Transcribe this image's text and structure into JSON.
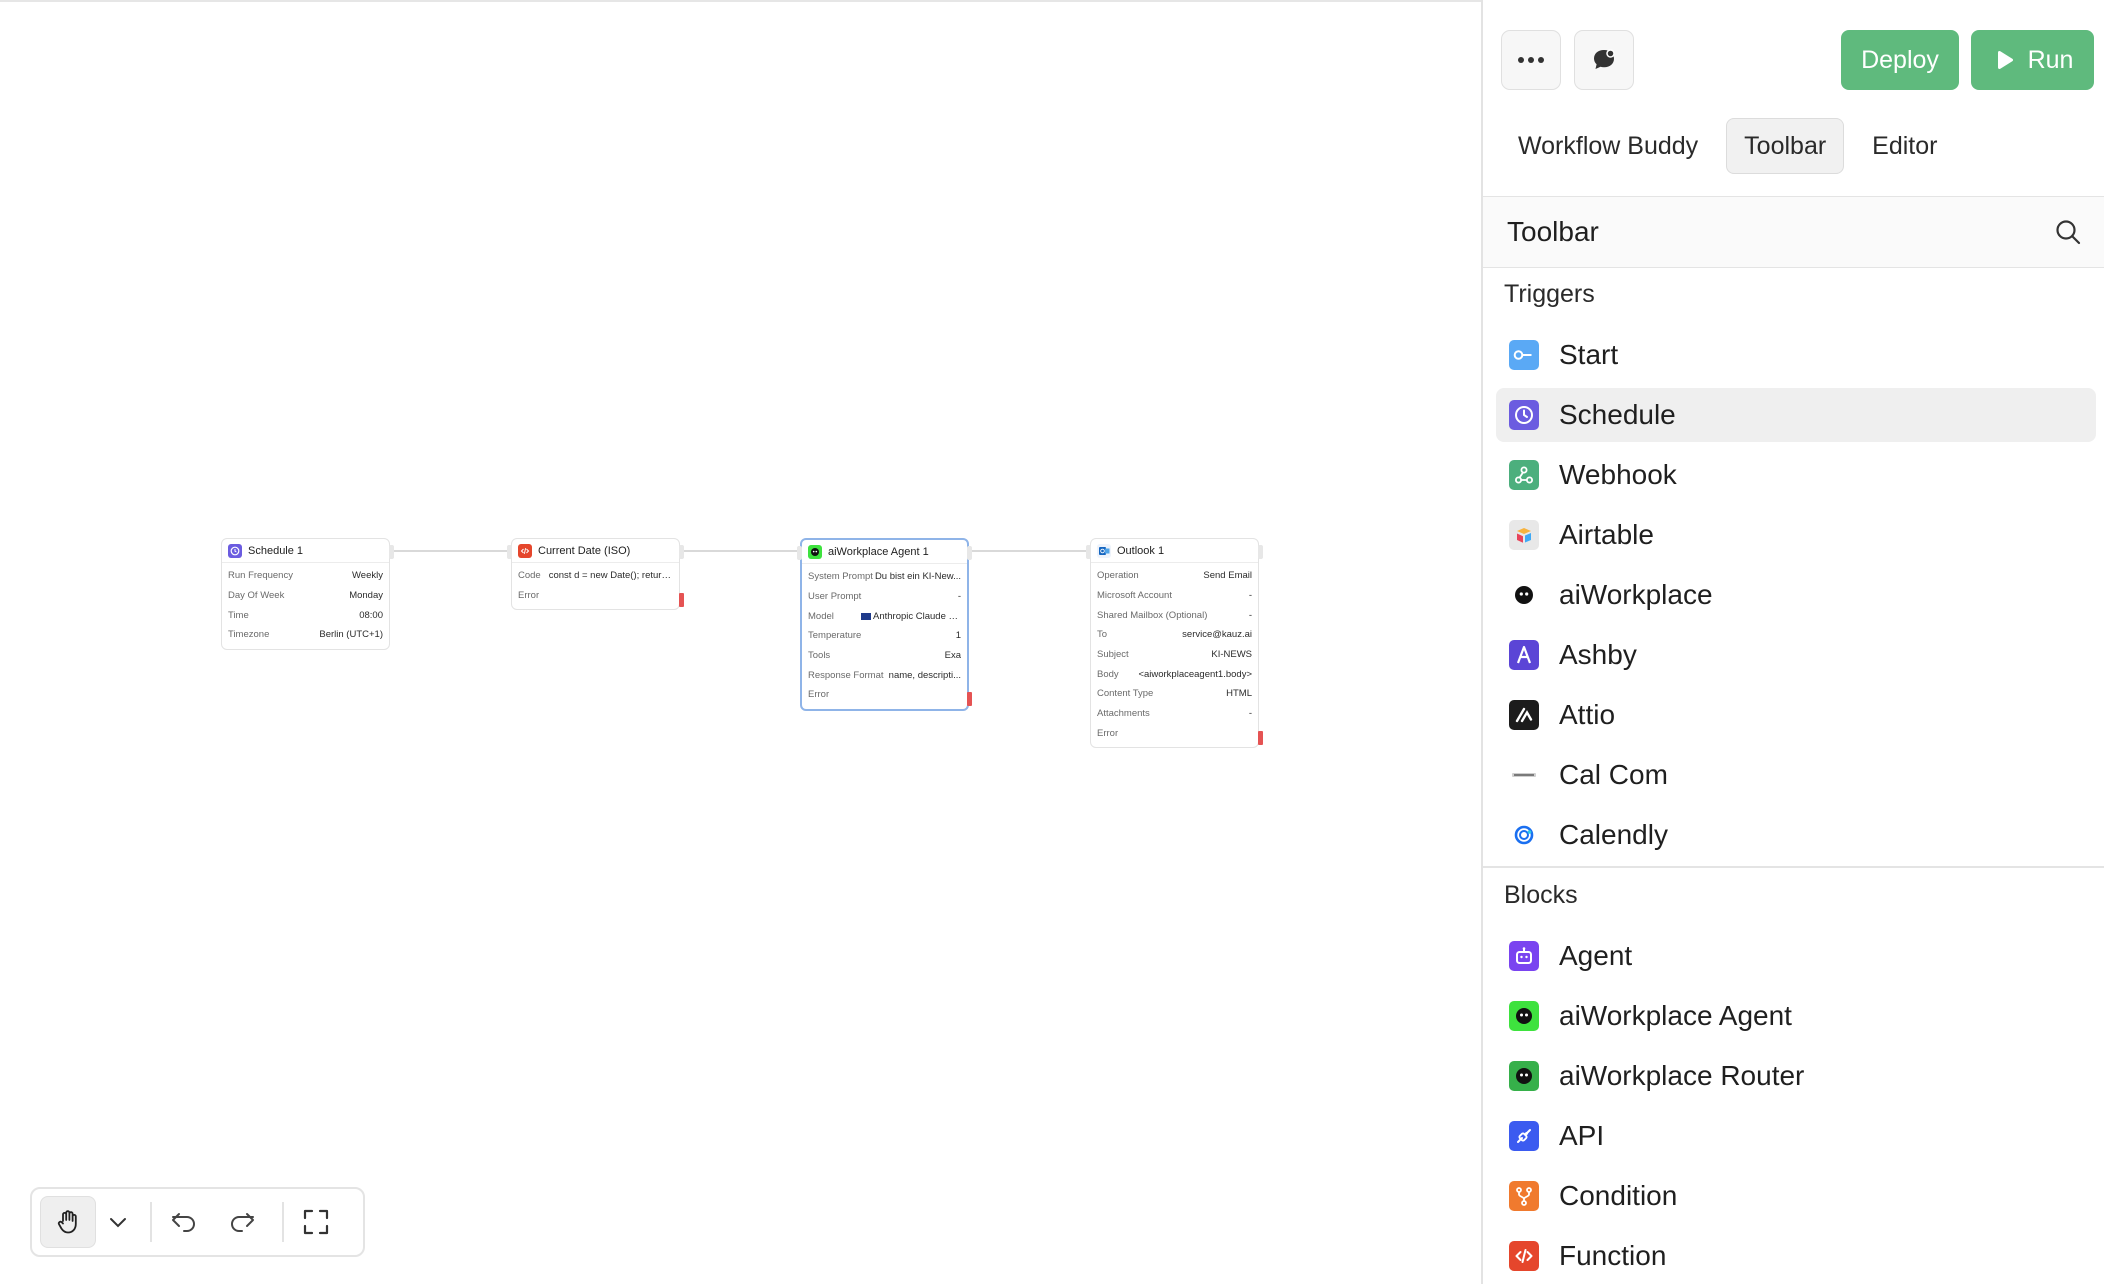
{
  "canvas": {
    "nodes": [
      {
        "id": "schedule",
        "title": "Schedule 1",
        "rows": [
          {
            "k": "Run Frequency",
            "v": "Weekly"
          },
          {
            "k": "Day Of Week",
            "v": "Monday"
          },
          {
            "k": "Time",
            "v": "08:00"
          },
          {
            "k": "Timezone",
            "v": "Berlin (UTC+1)"
          }
        ]
      },
      {
        "id": "current-date",
        "title": "Current Date (ISO)",
        "rows": [
          {
            "k": "Code",
            "v": "const d = new Date(); return ..."
          },
          {
            "k": "Error",
            "v": ""
          }
        ]
      },
      {
        "id": "aiworkplace-agent",
        "title": "aiWorkplace Agent 1",
        "rows": [
          {
            "k": "System Prompt",
            "v": "Du bist ein KI-New..."
          },
          {
            "k": "User Prompt",
            "v": "-"
          },
          {
            "k": "Model",
            "v": "Anthropic Claude Sonne..."
          },
          {
            "k": "Temperature",
            "v": "1"
          },
          {
            "k": "Tools",
            "v": "Exa"
          },
          {
            "k": "Response Format",
            "v": "name, descripti..."
          },
          {
            "k": "Error",
            "v": ""
          }
        ]
      },
      {
        "id": "outlook",
        "title": "Outlook 1",
        "rows": [
          {
            "k": "Operation",
            "v": "Send Email"
          },
          {
            "k": "Microsoft Account",
            "v": "-"
          },
          {
            "k": "Shared Mailbox (Optional)",
            "v": "-"
          },
          {
            "k": "To",
            "v": "service@kauz.ai"
          },
          {
            "k": "Subject",
            "v": "KI-NEWS"
          },
          {
            "k": "Body",
            "v": "<aiworkplaceagent1.body>"
          },
          {
            "k": "Content Type",
            "v": "HTML"
          },
          {
            "k": "Attachments",
            "v": "-"
          },
          {
            "k": "Error",
            "v": ""
          }
        ]
      }
    ]
  },
  "panel": {
    "deploy_label": "Deploy",
    "run_label": "Run",
    "tabs": [
      "Workflow Buddy",
      "Toolbar",
      "Editor"
    ],
    "active_tab": "Toolbar",
    "search_title": "Toolbar",
    "triggers_title": "Triggers",
    "triggers": [
      {
        "label": "Start",
        "icon": "start-icon",
        "color": "#5aa9f5"
      },
      {
        "label": "Schedule",
        "icon": "clock-icon",
        "color": "#6b5ce0"
      },
      {
        "label": "Webhook",
        "icon": "webhook-icon",
        "color": "#4caf7d"
      },
      {
        "label": "Airtable",
        "icon": "airtable-icon",
        "color": "#e8e8e8"
      },
      {
        "label": "aiWorkplace",
        "icon": "aiworkplace-icon",
        "color": "#ffffff"
      },
      {
        "label": "Ashby",
        "icon": "ashby-icon",
        "color": "#5b45d6"
      },
      {
        "label": "Attio",
        "icon": "attio-icon",
        "color": "#1c1c1c"
      },
      {
        "label": "Cal Com",
        "icon": "calcom-icon",
        "color": "#ffffff"
      },
      {
        "label": "Calendly",
        "icon": "calendly-icon",
        "color": "#ffffff"
      }
    ],
    "blocks_title": "Blocks",
    "blocks": [
      {
        "label": "Agent",
        "icon": "agent-icon",
        "color": "#7a44f0"
      },
      {
        "label": "aiWorkplace Agent",
        "icon": "aiworkplace-agent-icon",
        "color": "#3ee23e"
      },
      {
        "label": "aiWorkplace Router",
        "icon": "aiworkplace-router-icon",
        "color": "#36b04a"
      },
      {
        "label": "API",
        "icon": "api-icon",
        "color": "#3b5bf0"
      },
      {
        "label": "Condition",
        "icon": "condition-icon",
        "color": "#f07a2e"
      },
      {
        "label": "Function",
        "icon": "function-icon",
        "color": "#e5462c"
      }
    ]
  }
}
